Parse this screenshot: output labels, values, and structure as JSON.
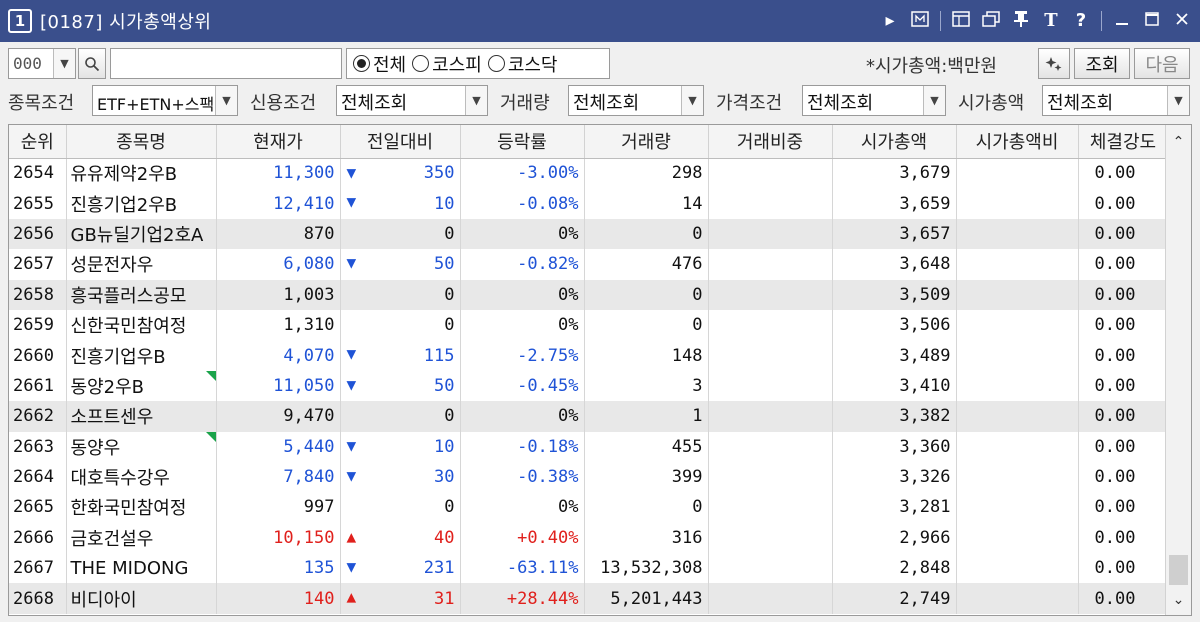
{
  "window": {
    "number": "1",
    "title": "[0187]  시가총액상위"
  },
  "title_icons": [
    "play-icon",
    "memo-icon",
    "window-icon",
    "restore-window-icon",
    "pin-icon",
    "font-icon",
    "help-icon",
    "minimize-icon",
    "maximize-icon",
    "close-icon"
  ],
  "toolbar": {
    "code_value": "000",
    "search_value": "",
    "market": {
      "options": [
        "전체",
        "코스피",
        "코스닥"
      ],
      "selected": "전체"
    },
    "cap_unit_label": "*시가총액:백만원",
    "query_label": "조회",
    "next_label": "다음"
  },
  "filters": {
    "stock_condition_label": "종목조건",
    "stock_condition_value": "ETF+ETN+스팩",
    "credit_label": "신용조건",
    "credit_value": "전체조회",
    "volume_label": "거래량",
    "volume_value": "전체조회",
    "price_label": "가격조건",
    "price_value": "전체조회",
    "cap_label": "시가총액",
    "cap_value": "전체조회"
  },
  "colors": {
    "up": "#e0201c",
    "down": "#1f53d6",
    "title_bar": "#3a4f8c"
  },
  "table": {
    "headers": [
      "순위",
      "종목명",
      "현재가",
      "전일대비",
      "등락률",
      "거래량",
      "거래비중",
      "시가총액",
      "시가총액비",
      "체결강도"
    ],
    "rows": [
      {
        "rank": "2654",
        "name": "유유제약2우B",
        "price": "11,300",
        "dir": "down",
        "change": "350",
        "rate": "-3.00%",
        "volume": "298",
        "ratio": "",
        "cap": "3,679",
        "capratio": "",
        "strength": "0.00",
        "mark": false
      },
      {
        "rank": "2655",
        "name": "진흥기업2우B",
        "price": "12,410",
        "dir": "down",
        "change": "10",
        "rate": "-0.08%",
        "volume": "14",
        "ratio": "",
        "cap": "3,659",
        "capratio": "",
        "strength": "0.00",
        "mark": false
      },
      {
        "rank": "2656",
        "name": "GB뉴딜기업2호A",
        "price": "870",
        "dir": "flat",
        "change": "0",
        "rate": "0%",
        "volume": "0",
        "ratio": "",
        "cap": "3,657",
        "capratio": "",
        "strength": "0.00",
        "mark": false
      },
      {
        "rank": "2657",
        "name": "성문전자우",
        "price": "6,080",
        "dir": "down",
        "change": "50",
        "rate": "-0.82%",
        "volume": "476",
        "ratio": "",
        "cap": "3,648",
        "capratio": "",
        "strength": "0.00",
        "mark": false
      },
      {
        "rank": "2658",
        "name": "흥국플러스공모",
        "price": "1,003",
        "dir": "flat",
        "change": "0",
        "rate": "0%",
        "volume": "0",
        "ratio": "",
        "cap": "3,509",
        "capratio": "",
        "strength": "0.00",
        "mark": false
      },
      {
        "rank": "2659",
        "name": "신한국민참여정",
        "price": "1,310",
        "dir": "flat",
        "change": "0",
        "rate": "0%",
        "volume": "0",
        "ratio": "",
        "cap": "3,506",
        "capratio": "",
        "strength": "0.00",
        "mark": false
      },
      {
        "rank": "2660",
        "name": "진흥기업우B",
        "price": "4,070",
        "dir": "down",
        "change": "115",
        "rate": "-2.75%",
        "volume": "148",
        "ratio": "",
        "cap": "3,489",
        "capratio": "",
        "strength": "0.00",
        "mark": false
      },
      {
        "rank": "2661",
        "name": "동양2우B",
        "price": "11,050",
        "dir": "down",
        "change": "50",
        "rate": "-0.45%",
        "volume": "3",
        "ratio": "",
        "cap": "3,410",
        "capratio": "",
        "strength": "0.00",
        "mark": true
      },
      {
        "rank": "2662",
        "name": "소프트센우",
        "price": "9,470",
        "dir": "flat",
        "change": "0",
        "rate": "0%",
        "volume": "1",
        "ratio": "",
        "cap": "3,382",
        "capratio": "",
        "strength": "0.00",
        "mark": false
      },
      {
        "rank": "2663",
        "name": "동양우",
        "price": "5,440",
        "dir": "down",
        "change": "10",
        "rate": "-0.18%",
        "volume": "455",
        "ratio": "",
        "cap": "3,360",
        "capratio": "",
        "strength": "0.00",
        "mark": true
      },
      {
        "rank": "2664",
        "name": "대호특수강우",
        "price": "7,840",
        "dir": "down",
        "change": "30",
        "rate": "-0.38%",
        "volume": "399",
        "ratio": "",
        "cap": "3,326",
        "capratio": "",
        "strength": "0.00",
        "mark": false
      },
      {
        "rank": "2665",
        "name": "한화국민참여정",
        "price": "997",
        "dir": "flat",
        "change": "0",
        "rate": "0%",
        "volume": "0",
        "ratio": "",
        "cap": "3,281",
        "capratio": "",
        "strength": "0.00",
        "mark": false
      },
      {
        "rank": "2666",
        "name": "금호건설우",
        "price": "10,150",
        "dir": "up",
        "change": "40",
        "rate": "+0.40%",
        "volume": "316",
        "ratio": "",
        "cap": "2,966",
        "capratio": "",
        "strength": "0.00",
        "mark": false
      },
      {
        "rank": "2667",
        "name": "THE MIDONG",
        "price": "135",
        "dir": "down",
        "change": "231",
        "rate": "-63.11%",
        "volume": "13,532,308",
        "ratio": "",
        "cap": "2,848",
        "capratio": "",
        "strength": "0.00",
        "mark": false
      },
      {
        "rank": "2668",
        "name": "비디아이",
        "price": "140",
        "dir": "up",
        "change": "31",
        "rate": "+28.44%",
        "volume": "5,201,443",
        "ratio": "",
        "cap": "2,749",
        "capratio": "",
        "strength": "0.00",
        "mark": false
      }
    ]
  }
}
